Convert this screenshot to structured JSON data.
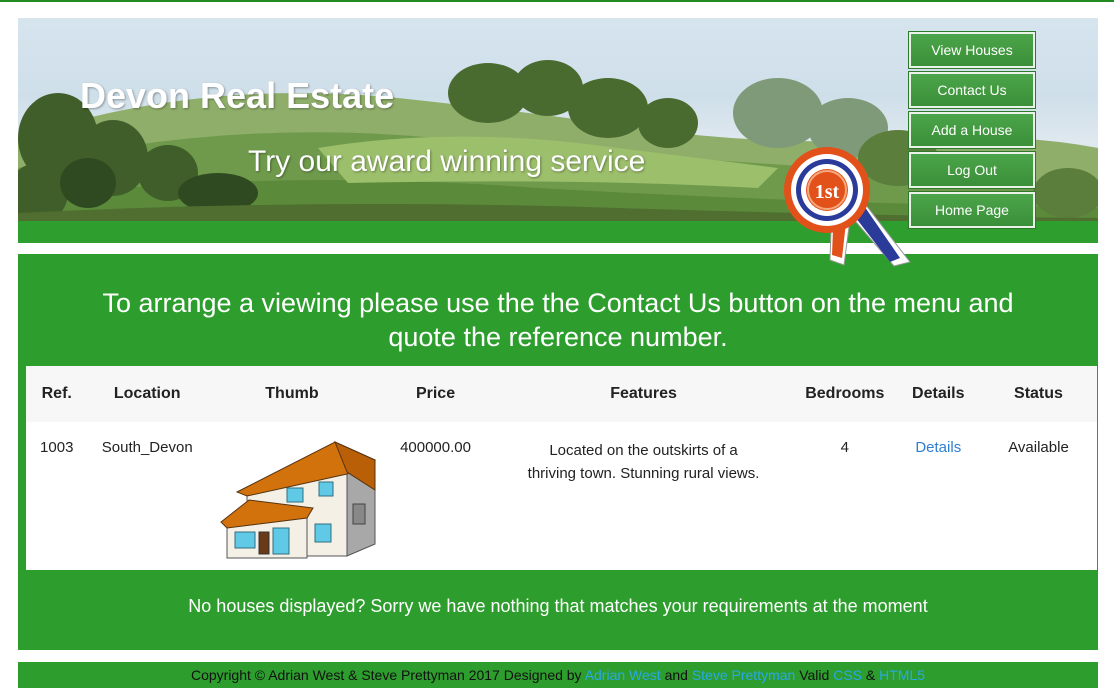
{
  "header": {
    "site_title": "Devon Real Estate",
    "slogan": "Try our award winning service",
    "badge_text": "1st"
  },
  "nav": {
    "items": [
      {
        "label": "View Houses"
      },
      {
        "label": "Contact Us"
      },
      {
        "label": "Add a House"
      },
      {
        "label": "Log Out"
      },
      {
        "label": "Home Page"
      }
    ]
  },
  "main": {
    "intro_line1": "To arrange a viewing please use the the Contact Us button on the menu and",
    "intro_line2": "quote the reference number.",
    "table": {
      "headers": [
        "Ref.",
        "Location",
        "Thumb",
        "Price",
        "Features",
        "Bedrooms",
        "Details",
        "Status"
      ],
      "rows": [
        {
          "ref": "1003",
          "location": "South_Devon",
          "thumb_icon": "house-thumbnail",
          "price": "400000.00",
          "features": "Located on the outskirts of a thriving town. Stunning rural views.",
          "bedrooms": "4",
          "details": "Details",
          "status": "Available"
        }
      ]
    },
    "notice": "No houses displayed? Sorry we have nothing that matches your requirements at the moment"
  },
  "footer": {
    "prefix": "Copyright © Adrian West & Steve Prettyman 2017 Designed by",
    "author1": "Adrian West",
    "and": "and",
    "author2": "Steve Prettyman",
    "valid": "Valid",
    "css": "CSS",
    "amp": "&",
    "html5": "HTML5"
  },
  "colors": {
    "brand_green": "#2d9e2d",
    "link_blue": "#2e7fd1",
    "footer_link": "#2aa7e8"
  }
}
